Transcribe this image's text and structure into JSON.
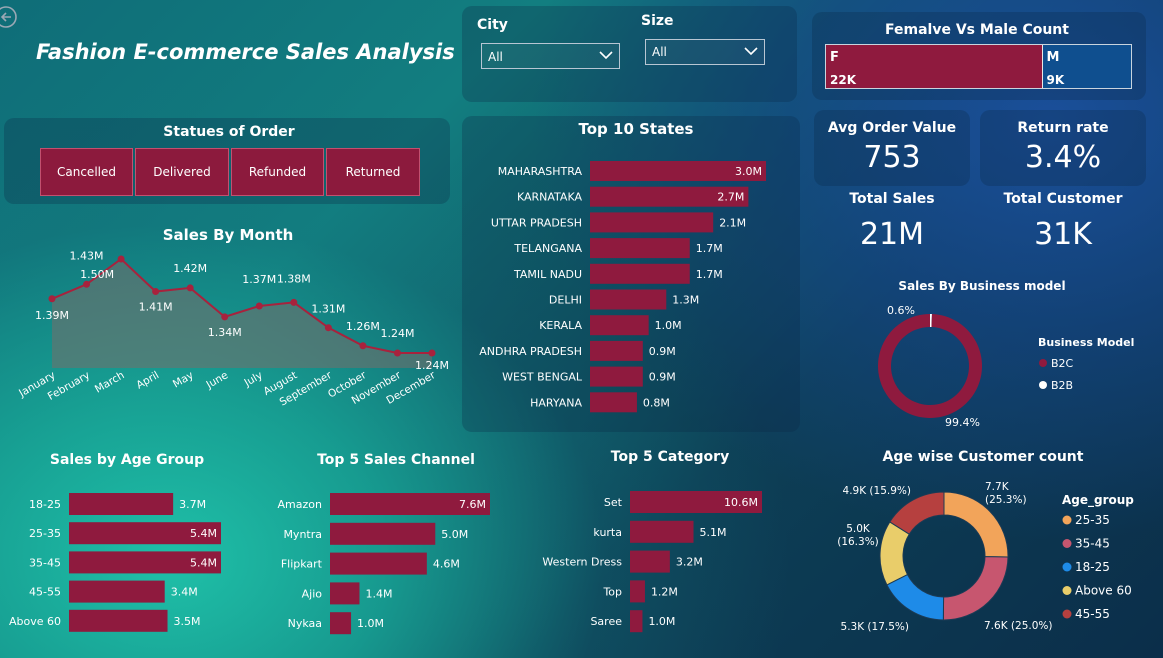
{
  "title": "Fashion E-commerce Sales Analysis",
  "filters": {
    "city": {
      "label": "City",
      "value": "All"
    },
    "size": {
      "label": "Size",
      "value": "All"
    }
  },
  "gender": {
    "title": "Femalve Vs Male Count",
    "female": {
      "label": "F",
      "value_text": "22K",
      "value": 22
    },
    "male": {
      "label": "M",
      "value_text": "9K",
      "value": 9
    }
  },
  "status": {
    "title": "Statues of Order",
    "buttons": [
      "Cancelled",
      "Delivered",
      "Refunded",
      "Returned"
    ]
  },
  "kpis": {
    "avg_order_label": "Avg Order Value",
    "avg_order_value": "753",
    "return_rate_label": "Return rate",
    "return_rate_value": "3.4%",
    "total_sales_label": "Total Sales",
    "total_sales_value": "21M",
    "total_customer_label": "Total Customer",
    "total_customer_value": "31K"
  },
  "colors": {
    "bar": "#8f1a3e",
    "line": "#a8223d",
    "b2c": "#8f1a3e",
    "b2b": "#ffffff",
    "male": "#0f4f8f"
  },
  "chart_data": [
    {
      "id": "sales_by_month",
      "type": "area",
      "title": "Sales By Month",
      "categories": [
        "January",
        "February",
        "March",
        "April",
        "May",
        "June",
        "July",
        "August",
        "September",
        "October",
        "November",
        "December"
      ],
      "values": [
        1.39,
        1.43,
        1.5,
        1.41,
        1.42,
        1.34,
        1.37,
        1.38,
        1.31,
        1.26,
        1.24,
        1.24
      ],
      "labels": [
        "1.39M",
        "1.43M",
        "1.50M",
        "1.41M",
        "1.42M",
        "1.34M",
        "1.37M",
        "1.38M",
        "1.31M",
        "1.26M",
        "1.24M",
        "1.24M"
      ],
      "grid": false
    },
    {
      "id": "top_states",
      "type": "bar",
      "title": "Top 10 States",
      "categories": [
        "MAHARASHTRA",
        "KARNATAKA",
        "UTTAR PRADESH",
        "TELANGANA",
        "TAMIL NADU",
        "DELHI",
        "KERALA",
        "ANDHRA PRADESH",
        "WEST BENGAL",
        "HARYANA"
      ],
      "values": [
        3.0,
        2.7,
        2.1,
        1.7,
        1.7,
        1.3,
        1.0,
        0.9,
        0.9,
        0.8
      ],
      "labels": [
        "3.0M",
        "2.7M",
        "2.1M",
        "1.7M",
        "1.7M",
        "1.3M",
        "1.0M",
        "0.9M",
        "0.9M",
        "0.8M"
      ],
      "inside_label_count": 2
    },
    {
      "id": "age_group_sales",
      "type": "bar",
      "title": "Sales by Age Group",
      "categories": [
        "18-25",
        "25-35",
        "35-45",
        "45-55",
        "Above 60"
      ],
      "values": [
        3.7,
        5.4,
        5.4,
        3.4,
        3.5
      ],
      "labels": [
        "3.7M",
        "5.4M",
        "5.4M",
        "3.4M",
        "3.5M"
      ],
      "inside_label_count": 0,
      "inside_flags": [
        false,
        true,
        true,
        false,
        false
      ]
    },
    {
      "id": "sales_channel",
      "type": "bar",
      "title": "Top 5 Sales Channel",
      "categories": [
        "Amazon",
        "Myntra",
        "Flipkart",
        "Ajio",
        "Nykaa"
      ],
      "values": [
        7.6,
        5.0,
        4.6,
        1.4,
        1.0
      ],
      "labels": [
        "7.6M",
        "5.0M",
        "4.6M",
        "1.4M",
        "1.0M"
      ],
      "inside_label_count": 1
    },
    {
      "id": "top_category",
      "type": "bar",
      "title": "Top 5 Category",
      "categories": [
        "Set",
        "kurta",
        "Western Dress",
        "Top",
        "Saree"
      ],
      "values": [
        10.6,
        5.1,
        3.2,
        1.2,
        1.0
      ],
      "labels": [
        "10.6M",
        "5.1M",
        "3.2M",
        "1.2M",
        "1.0M"
      ],
      "inside_label_count": 1
    },
    {
      "id": "business_model",
      "type": "pie",
      "title": "Sales By Business model",
      "legend_title": "Business Model",
      "legend_position": "right",
      "slices": [
        {
          "name": "B2C",
          "value": 99.4,
          "label": "99.4%",
          "color": "#8f1a3e"
        },
        {
          "name": "B2B",
          "value": 0.6,
          "label": "0.6%",
          "color": "#ffffff"
        }
      ]
    },
    {
      "id": "age_customer",
      "type": "pie",
      "title": "Age wise Customer count",
      "legend_title": "Age_group",
      "legend_position": "right",
      "slices": [
        {
          "name": "25-35",
          "value": 7.7,
          "label": "7.7K (25.3%)",
          "color": "#f2a45a"
        },
        {
          "name": "35-45",
          "value": 7.6,
          "label": "7.6K (25.0%)",
          "color": "#c7566f"
        },
        {
          "name": "18-25",
          "value": 5.3,
          "label": "5.3K (17.5%)",
          "color": "#1e8be8"
        },
        {
          "name": "Above 60",
          "value": 5.0,
          "label": "5.0K (16.3%)",
          "color": "#e9cd6a"
        },
        {
          "name": "45-55",
          "value": 4.9,
          "label": "4.9K (15.9%)",
          "color": "#b6403f"
        }
      ]
    }
  ]
}
